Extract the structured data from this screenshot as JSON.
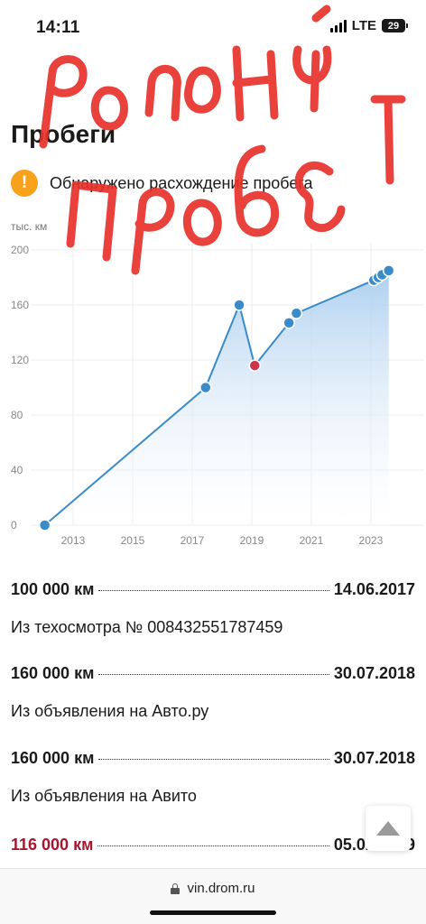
{
  "status_bar": {
    "time": "14:11",
    "network": "LTE",
    "battery": "29"
  },
  "page": {
    "title": "Пробеги",
    "warning_text": "Обнаружено расхождение пробега"
  },
  "chart_data": {
    "type": "line",
    "unit_label": "тыс. км",
    "ylim": [
      0,
      200
    ],
    "y_ticks": [
      "0",
      "40",
      "80",
      "120",
      "160",
      "200"
    ],
    "xlim": [
      2012,
      2023.7
    ],
    "x_ticks": [
      "2013",
      "2015",
      "2017",
      "2019",
      "2021",
      "2023"
    ],
    "grid": true,
    "series": [
      {
        "points": [
          {
            "x": 2012.05,
            "y": 0,
            "flag": "ok"
          },
          {
            "x": 2017.45,
            "y": 100,
            "flag": "ok"
          },
          {
            "x": 2018.58,
            "y": 160,
            "flag": "ok"
          },
          {
            "x": 2019.1,
            "y": 116,
            "flag": "bad"
          },
          {
            "x": 2020.25,
            "y": 147,
            "flag": "ok"
          },
          {
            "x": 2020.5,
            "y": 154,
            "flag": "ok"
          },
          {
            "x": 2023.1,
            "y": 178,
            "flag": "ok"
          },
          {
            "x": 2023.25,
            "y": 180,
            "flag": "ok"
          },
          {
            "x": 2023.38,
            "y": 182,
            "flag": "ok"
          },
          {
            "x": 2023.6,
            "y": 185,
            "flag": "ok"
          }
        ]
      }
    ],
    "colors": {
      "line": "#3a8bc9",
      "point": "#3a8bc9",
      "bad_point": "#c8374a",
      "fill_top": "#a9cdef"
    }
  },
  "entries": [
    {
      "km": "100 000 км",
      "date": "14.06.2017",
      "source": "Из техосмотра № 008432551787459",
      "bad": false
    },
    {
      "km": "160 000 км",
      "date": "30.07.2018",
      "source": "Из объявления на Авто.ру",
      "bad": false
    },
    {
      "km": "160 000 км",
      "date": "30.07.2018",
      "source": "Из объявления на Авито",
      "bad": false
    },
    {
      "km": "116 000 км",
      "date": "05.02.2019",
      "source": "",
      "bad": true
    }
  ],
  "browser": {
    "url": "vin.drom.ru"
  },
  "annotation": {
    "text": "родной пробег",
    "color": "#e8312b"
  }
}
